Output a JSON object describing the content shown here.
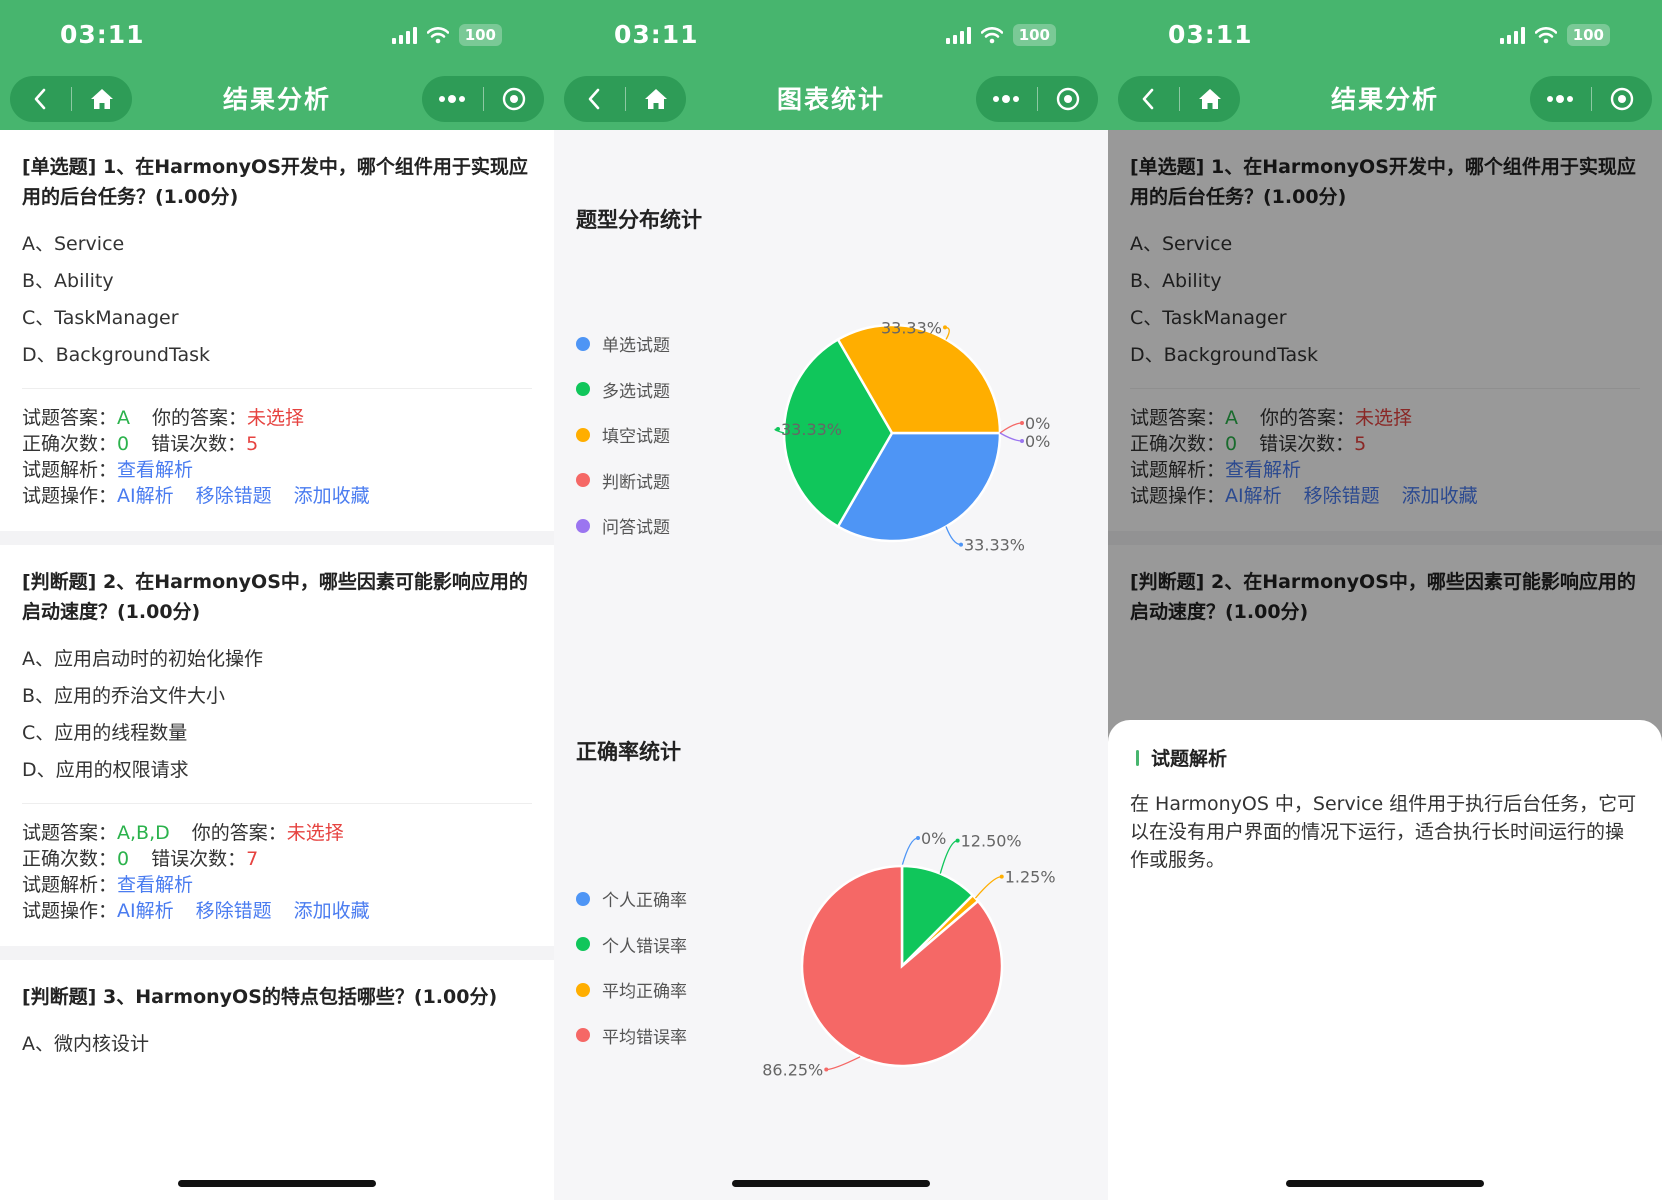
{
  "status": {
    "time": "03:11",
    "battery": "100"
  },
  "screens": [
    {
      "nav_title": "结果分析"
    },
    {
      "nav_title": "图表统计"
    },
    {
      "nav_title": "结果分析"
    }
  ],
  "labels": {
    "answer": "试题答案：",
    "your_answer": "你的答案：",
    "correct_count": "正确次数：",
    "wrong_count": "错误次数：",
    "explanation": "试题解析：",
    "operations": "试题操作：",
    "view_explanation": "查看解析",
    "ai_explanation": "AI解析",
    "remove_wrong": "移除错题",
    "add_favorite": "添加收藏",
    "not_selected": "未选择"
  },
  "questions": [
    {
      "title": "[单选题] 1、在HarmonyOS开发中，哪个组件用于实现应用的后台任务？(1.00分)",
      "options": [
        "A、Service",
        "B、Ability",
        "C、TaskManager",
        "D、BackgroundTask"
      ],
      "answer": "A",
      "correct": "0",
      "wrong": "5"
    },
    {
      "title": "[判断题] 2、在HarmonyOS中，哪些因素可能影响应用的启动速度？(1.00分)",
      "options": [
        "A、应用启动时的初始化操作",
        "B、应用的乔治文件大小",
        "C、应用的线程数量",
        "D、应用的权限请求"
      ],
      "answer": "A,B,D",
      "correct": "0",
      "wrong": "7"
    },
    {
      "title": "[判断题] 3、HarmonyOS的特点包括哪些？(1.00分)",
      "options": [
        "A、微内核设计"
      ]
    }
  ],
  "chart_data": [
    {
      "type": "pie",
      "title": "题型分布统计",
      "categories": [
        "单选试题",
        "多选试题",
        "填空试题",
        "判断试题",
        "问答试题"
      ],
      "values": [
        33.33,
        33.33,
        33.33,
        0,
        0
      ],
      "value_labels": [
        "33.33%",
        "33.33%",
        "33.33%",
        "0%",
        "0%"
      ],
      "colors": [
        "#4e95f5",
        "#10c65b",
        "#ffae00",
        "#f56866",
        "#9b75f0"
      ],
      "legend": "left"
    },
    {
      "type": "pie",
      "title": "正确率统计",
      "categories": [
        "个人正确率",
        "个人错误率",
        "平均正确率",
        "平均错误率"
      ],
      "values": [
        0,
        12.5,
        1.25,
        86.25
      ],
      "value_labels": [
        "0%",
        "12.50%",
        "1.25%",
        "86.25%"
      ],
      "colors": [
        "#4e95f5",
        "#10c65b",
        "#ffae00",
        "#f56866"
      ],
      "legend": "left"
    }
  ],
  "sheet": {
    "title": "试题解析",
    "body": "在 HarmonyOS 中，Service 组件用于执行后台任务，它可以在没有用户界面的情况下运行，适合执行长时间运行的操作或服务。"
  }
}
